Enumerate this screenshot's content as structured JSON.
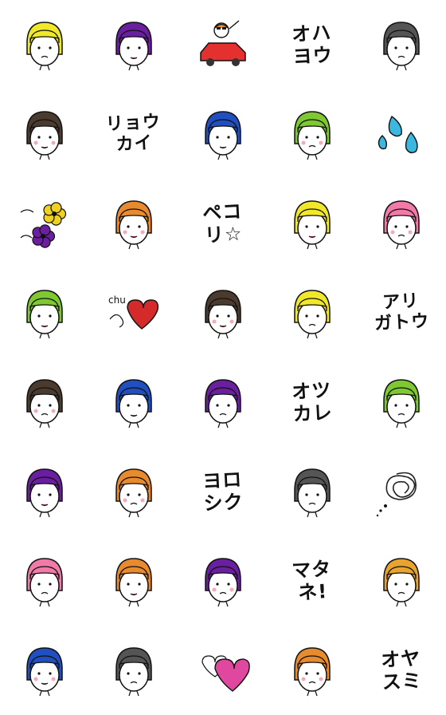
{
  "stickers": [
    {
      "id": 1,
      "kind": "face",
      "hair": "#f2e82a",
      "icon": "yellow-bob-girl-icon"
    },
    {
      "id": 2,
      "kind": "face",
      "hair": "#6a1fa0",
      "icon": "purple-bob-angry-girl-icon"
    },
    {
      "id": 3,
      "kind": "car",
      "accent": "#e53030",
      "icon": "girl-in-red-car-icon"
    },
    {
      "id": 4,
      "kind": "text",
      "lines": [
        "オハ",
        "ヨウ"
      ]
    },
    {
      "id": 5,
      "kind": "face",
      "hair": "#555555",
      "icon": "gray-hair-glasses-man-icon"
    },
    {
      "id": 6,
      "kind": "face",
      "hair": "#4a3b2e",
      "icon": "peace-sign-girl-icon"
    },
    {
      "id": 7,
      "kind": "text",
      "lines": [
        "リョウ",
        "カイ"
      ]
    },
    {
      "id": 8,
      "kind": "face",
      "hair": "#1f4fc0",
      "icon": "blue-hair-fist-pump-icon"
    },
    {
      "id": 9,
      "kind": "face",
      "hair": "#7ec832",
      "icon": "green-hair-crying-icon"
    },
    {
      "id": 10,
      "kind": "drops",
      "accent": "#3bb7e0",
      "icon": "sweat-drops-icon"
    },
    {
      "id": 11,
      "kind": "flowers",
      "accent": "#f0d020",
      "icon": "yellow-purple-flowers-icon"
    },
    {
      "id": 12,
      "kind": "face",
      "hair": "#e88a2e",
      "icon": "orange-hair-thinking-icon"
    },
    {
      "id": 13,
      "kind": "text",
      "lines": [
        "ペコ",
        "リ☆"
      ]
    },
    {
      "id": 14,
      "kind": "face",
      "hair": "#f2e82a",
      "icon": "yellow-hair-bowing-icon"
    },
    {
      "id": 15,
      "kind": "face",
      "hair": "#f27aa8",
      "icon": "pink-hair-dark-face-icon"
    },
    {
      "id": 16,
      "kind": "face",
      "hair": "#7ec832",
      "icon": "green-hair-waving-icon"
    },
    {
      "id": 17,
      "kind": "heart",
      "accent": "#d42a2a",
      "label": "chu",
      "icon": "chu-heart-icon"
    },
    {
      "id": 18,
      "kind": "face",
      "hair": "#4a3b2e",
      "icon": "bun-hair-surprised-icon"
    },
    {
      "id": 19,
      "kind": "face",
      "hair": "#f2e82a",
      "icon": "yellow-hair-peekaboo-icon"
    },
    {
      "id": 20,
      "kind": "text",
      "lines": [
        "アリ",
        "ガトウ"
      ]
    },
    {
      "id": 21,
      "kind": "face",
      "hair": "#4a3b2e",
      "icon": "bun-hair-tongue-icon"
    },
    {
      "id": 22,
      "kind": "face",
      "hair": "#1f4fc0",
      "icon": "blue-hair-dancing-icon"
    },
    {
      "id": 23,
      "kind": "face",
      "hair": "#6a1fa0",
      "icon": "purple-long-hair-icon"
    },
    {
      "id": 24,
      "kind": "text",
      "lines": [
        "オツ",
        "カレ"
      ]
    },
    {
      "id": 25,
      "kind": "face",
      "hair": "#7ec832",
      "icon": "green-hair-covering-mouth-icon"
    },
    {
      "id": 26,
      "kind": "face",
      "hair": "#6a1fa0",
      "icon": "purple-hair-stretching-icon"
    },
    {
      "id": 27,
      "kind": "face",
      "hair": "#e88a2e",
      "icon": "orange-hair-stretching-icon"
    },
    {
      "id": 28,
      "kind": "text",
      "lines": [
        "ヨロ",
        "シク"
      ]
    },
    {
      "id": 29,
      "kind": "face",
      "hair": "#555555",
      "icon": "glasses-man-sweating-icon"
    },
    {
      "id": 30,
      "kind": "scribble",
      "accent": "#222222",
      "icon": "scribble-thought-icon"
    },
    {
      "id": 31,
      "kind": "face",
      "hair": "#f27aa8",
      "icon": "pink-hair-big-lips-icon"
    },
    {
      "id": 32,
      "kind": "face",
      "hair": "#e88a2e",
      "icon": "mirror-pose-icon"
    },
    {
      "id": 33,
      "kind": "face",
      "hair": "#6a1fa0",
      "icon": "purple-hair-walking-icon"
    },
    {
      "id": 34,
      "kind": "text",
      "lines": [
        "マタ",
        "ネ!"
      ]
    },
    {
      "id": 35,
      "kind": "face",
      "hair": "#e8a42e",
      "icon": "orange-hair-sunset-crying-icon"
    },
    {
      "id": 36,
      "kind": "face",
      "hair": "#1f4fc0",
      "icon": "blue-hair-flood-crying-icon"
    },
    {
      "id": 37,
      "kind": "face",
      "hair": "#555555",
      "icon": "backbend-pose-icon"
    },
    {
      "id": 38,
      "kind": "hearts",
      "accent": "#e0479e",
      "icon": "pink-glitter-hearts-icon"
    },
    {
      "id": 39,
      "kind": "face",
      "hair": "#e88a2e",
      "icon": "upside-down-girl-icon"
    },
    {
      "id": 40,
      "kind": "text",
      "lines": [
        "オヤ",
        "スミ"
      ]
    }
  ]
}
